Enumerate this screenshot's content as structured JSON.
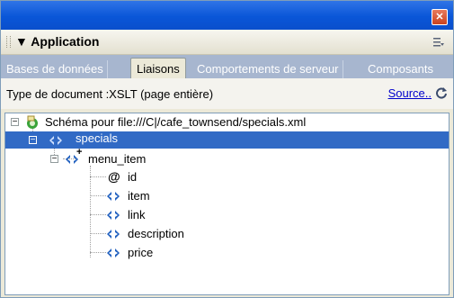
{
  "window": {
    "close_glyph": "✕"
  },
  "panel": {
    "title": "▼ Application",
    "options_icon": "options-menu-icon"
  },
  "tabs": [
    {
      "label": "Bases de données",
      "active": false
    },
    {
      "label": "Liaisons",
      "active": true
    },
    {
      "label": "Comportements de serveur",
      "active": false
    },
    {
      "label": "Composants",
      "active": false
    }
  ],
  "doc": {
    "type_label": "Type de document :XSLT (page entière)",
    "source_link": "Source..",
    "refresh_icon": "refresh-icon"
  },
  "tree": {
    "root_label": "Schéma pour file:///C|/cafe_townsend/specials.xml",
    "root_collapse": "−",
    "specials_label": "specials",
    "specials_collapse": "−",
    "menu_item_label": "menu_item",
    "menu_item_collapse": "−",
    "menu_item_repeat": "+",
    "attribute_glyph": "@",
    "children": [
      "id",
      "item",
      "link",
      "description",
      "price"
    ]
  },
  "colors": {
    "titlebar": "#0a56d8",
    "tabbar": "#a7b6cf",
    "selection": "#316ac5",
    "link": "#0000cc"
  }
}
